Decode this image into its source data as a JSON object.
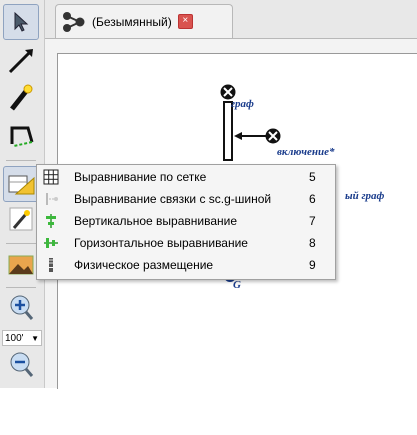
{
  "tab": {
    "title": "(Безымянный)",
    "close": "×"
  },
  "toolbar": {
    "zoom": "100'",
    "zoom_arrow": "▼"
  },
  "graph": {
    "label_top": "граф",
    "label_right": "включение*",
    "label_partial": "ый граф",
    "label_bottom": "G"
  },
  "menu": {
    "items": [
      {
        "label": "Выравнивание по сетке",
        "shortcut": "5",
        "icon": "grid-icon"
      },
      {
        "label": "Выравнивание связки с sc.g-шиной",
        "shortcut": "6",
        "icon": "bus-align-icon"
      },
      {
        "label": "Вертикальное выравнивание",
        "shortcut": "7",
        "icon": "vertical-align-icon"
      },
      {
        "label": "Горизонтальное выравнивание",
        "shortcut": "8",
        "icon": "horizontal-align-icon"
      },
      {
        "label": "Физическое размещение",
        "shortcut": "9",
        "icon": "physics-layout-icon"
      }
    ]
  }
}
